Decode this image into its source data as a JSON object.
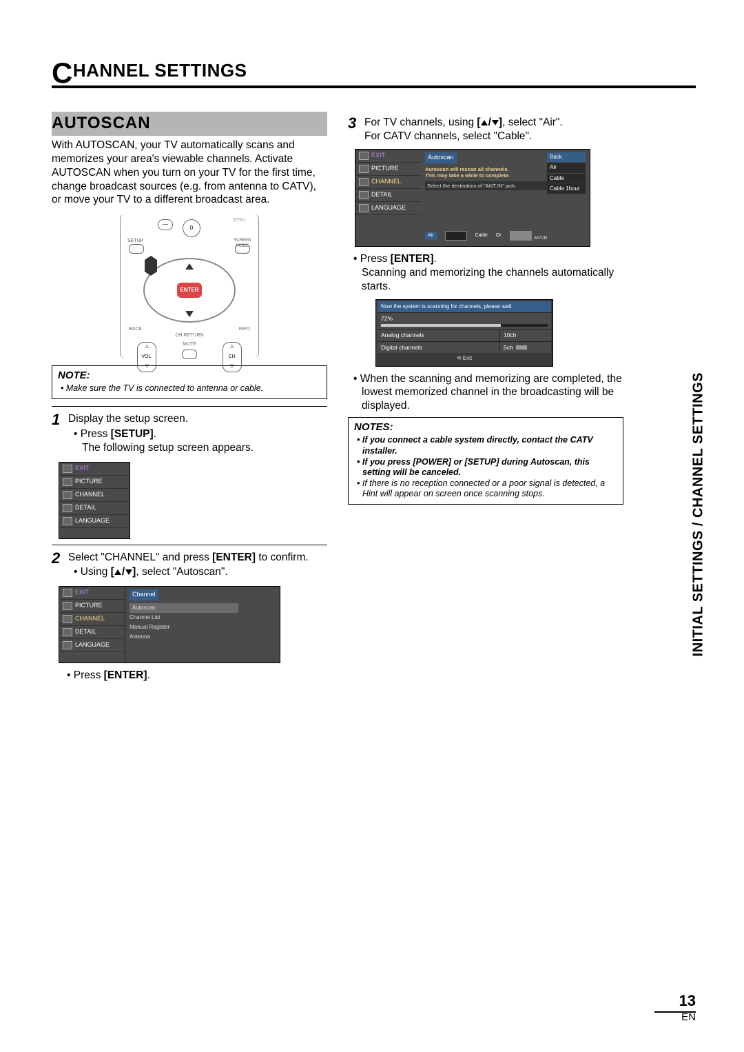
{
  "header": {
    "title_cap": "C",
    "title_rest": "HANNEL SETTINGS"
  },
  "side_label": "INITIAL SETTINGS / CHANNEL SETTINGS",
  "section": {
    "heading": "AUTOSCAN"
  },
  "intro": "With AUTOSCAN, your TV automatically scans and memorizes your area's viewable channels. Activate AUTOSCAN when you turn on your TV for the first time, change broadcast sources (e.g. from antenna to CATV), or move your TV to a different broadcast area.",
  "remote": {
    "digit": "0",
    "enter": "ENTER",
    "setup": "SETUP",
    "still": "STILL",
    "screen_mode": "SCREEN MODE",
    "back": "BACK",
    "info": "INFO",
    "ch_return": "CH RETURN",
    "vol": "VOL.",
    "mute": "MUTE",
    "ch": "CH"
  },
  "note1": {
    "title": "NOTE:",
    "items": [
      "Make sure the TV is connected to antenna or cable."
    ]
  },
  "steps": {
    "s1": {
      "num": "1",
      "line1": "Display the setup screen.",
      "b1a": "Press ",
      "b1b": "[SETUP]",
      "b1c": ".",
      "line2": "The following setup screen appears."
    },
    "s2": {
      "num": "2",
      "line1a": "Select \"CHANNEL\" and press ",
      "line1b": "[ENTER]",
      "line1c": " to confirm.",
      "b1a": "Using ",
      "b1b": ", select \"Autoscan\".",
      "b2a": "Press ",
      "b2b": "[ENTER]",
      "b2c": "."
    },
    "s3": {
      "num": "3",
      "line1a": "For TV channels, using ",
      "line1b": ", select \"Air\".",
      "line2": "For CATV channels, select \"Cable\".",
      "b1a": "Press ",
      "b1b": "[ENTER]",
      "b1c": ".",
      "line3": "Scanning and memorizing the channels automatically starts.",
      "b2": "When the scanning and memorizing are completed, the lowest memorized channel in the broadcasting will be displayed."
    }
  },
  "osd_menu": {
    "exit": "EXIT",
    "picture": "PICTURE",
    "channel": "CHANNEL",
    "detail": "DETAIL",
    "language": "LANGUAGE"
  },
  "osd_channel": {
    "title": "Channel",
    "items": [
      "Autoscan",
      "Channel List",
      "Manual Register",
      "Antenna"
    ]
  },
  "osd_autoscan": {
    "title": "Autoscan",
    "msg1": "Autoscan will rescan all channels.",
    "msg2": "This may take a while to complete.",
    "msg3": "Select the destination of \"ANT IN\" jack.",
    "air": "Air",
    "cable": "Cable",
    "or": "Or",
    "ant_in": "ANT.IN",
    "options": [
      "Back",
      "Air",
      "Cable",
      "Cable 1hour"
    ]
  },
  "osd_scan": {
    "msg": "Now the system is scanning for channels, please wait.",
    "percent": "72%",
    "analog_l": "Analog channels",
    "analog_v": "10ch",
    "digital_l": "Digital channels",
    "digital_v": "5ch",
    "exit": "Exit"
  },
  "notes2": {
    "title": "NOTES:",
    "items": [
      "If you connect a cable system directly, contact the CATV installer.",
      "If you press [POWER] or [SETUP] during Autoscan, this setting will be canceled.",
      "If there is no reception connected or a poor signal is detected, a Hint will appear on screen once scanning stops."
    ]
  },
  "footer": {
    "page": "13",
    "lang": "EN"
  }
}
